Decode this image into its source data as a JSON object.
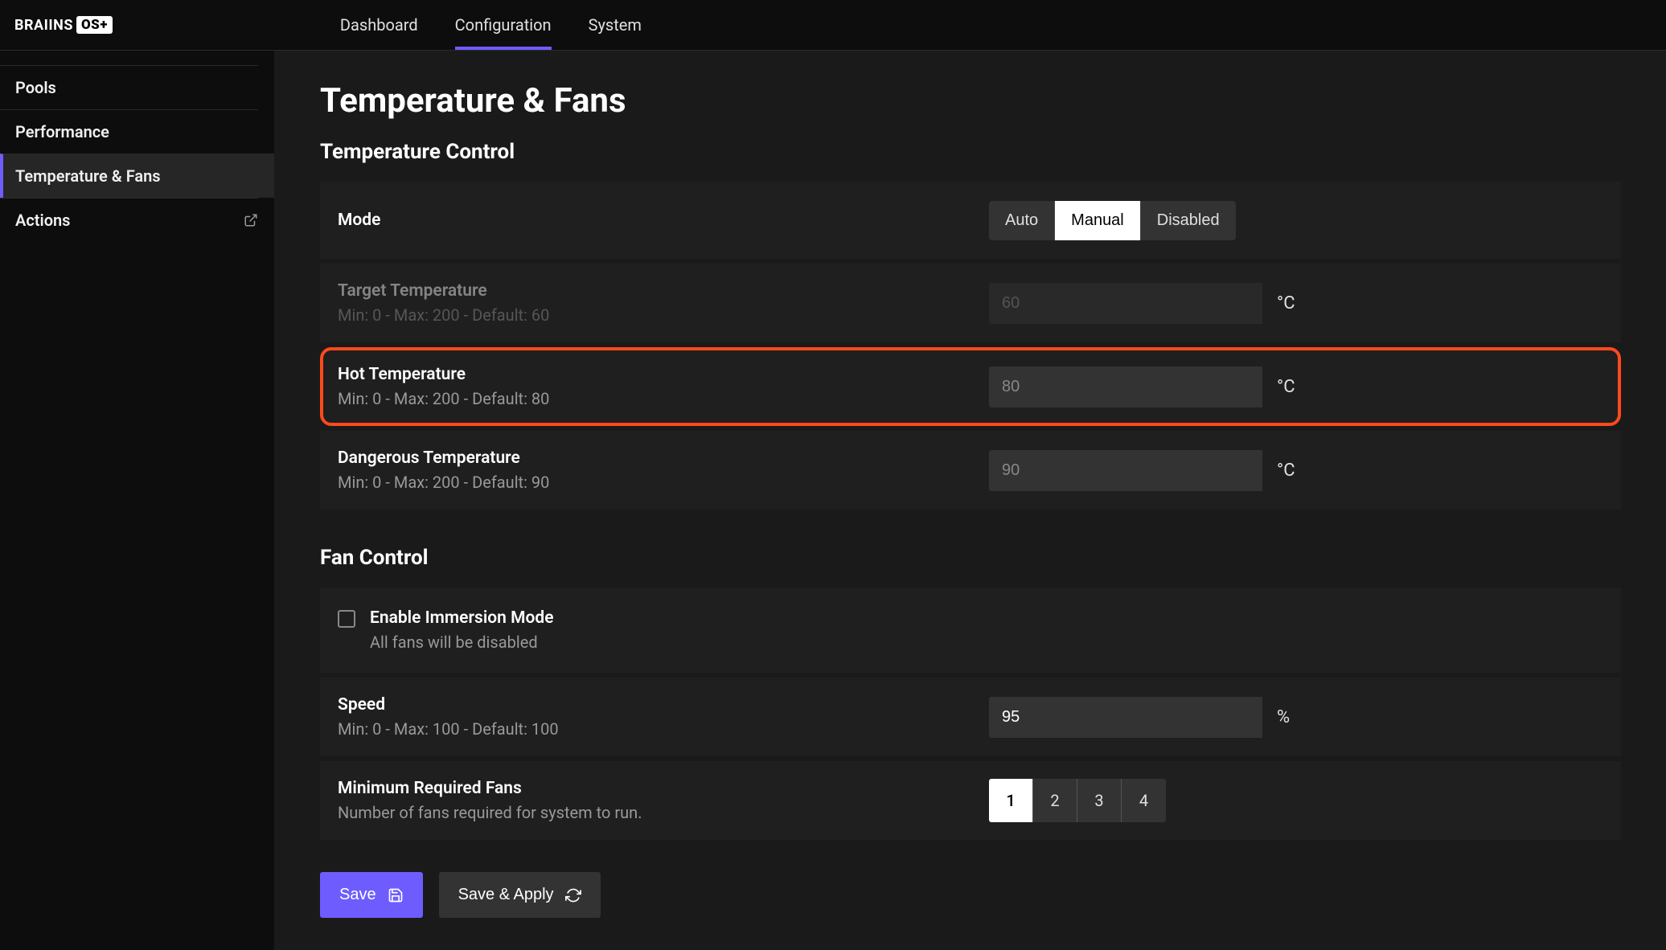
{
  "logo": {
    "text": "BRAIINS",
    "badge": "OS+"
  },
  "topnav": [
    {
      "label": "Dashboard",
      "active": false
    },
    {
      "label": "Configuration",
      "active": true
    },
    {
      "label": "System",
      "active": false
    }
  ],
  "sidenav": [
    {
      "label": "Pools"
    },
    {
      "label": "Performance"
    },
    {
      "label": "Temperature & Fans",
      "active": true
    },
    {
      "label": "Actions",
      "external": true
    }
  ],
  "page_title": "Temperature & Fans",
  "temp_section": {
    "title": "Temperature Control",
    "mode": {
      "label": "Mode",
      "options": [
        "Auto",
        "Manual",
        "Disabled"
      ],
      "selected": "Manual"
    },
    "target": {
      "label": "Target Temperature",
      "range_text": "Min: 0  -  Max: 200  -  Default: 60",
      "placeholder": "60",
      "value": "",
      "unit": "°C"
    },
    "hot": {
      "label": "Hot Temperature",
      "range_text": "Min: 0  -  Max: 200  -  Default: 80",
      "placeholder": "80",
      "value": "",
      "unit": "°C"
    },
    "dangerous": {
      "label": "Dangerous Temperature",
      "range_text": "Min: 0  -  Max: 200  -  Default: 90",
      "placeholder": "90",
      "value": "",
      "unit": "°C"
    }
  },
  "fan_section": {
    "title": "Fan Control",
    "immersion": {
      "label": "Enable Immersion Mode",
      "sub": "All fans will be disabled",
      "checked": false
    },
    "speed": {
      "label": "Speed",
      "range_text": "Min: 0  -  Max: 100  -  Default: 100",
      "value": "95",
      "unit": "%"
    },
    "min_fans": {
      "label": "Minimum Required Fans",
      "sub": "Number of fans required for system to run.",
      "options": [
        "1",
        "2",
        "3",
        "4"
      ],
      "selected": "1"
    }
  },
  "buttons": {
    "save": "Save",
    "save_apply": "Save & Apply"
  }
}
